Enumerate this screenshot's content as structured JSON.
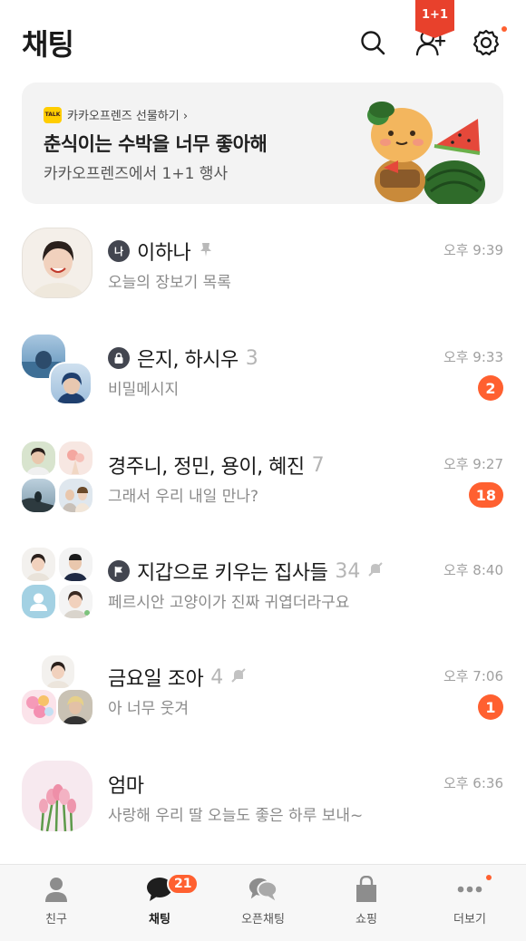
{
  "header": {
    "title": "채팅",
    "icons": [
      "search-icon",
      "add-friend-icon",
      "settings-icon"
    ],
    "settings_has_new": true
  },
  "banner": {
    "source": "카카오프렌즈 선물하기 ›",
    "source_logo": "TALK",
    "headline": "춘식이는 수박을 너무 좋아해",
    "subtitle": "카카오프렌즈에서 1+1 행사",
    "promo_tag": "1+1"
  },
  "chats": [
    {
      "name": "이하나",
      "count": "",
      "preview": "오늘의 장보기 목록",
      "time": "오후 9:39",
      "unread": "",
      "leading_icon": "나",
      "pinned": true,
      "muted": false
    },
    {
      "name": "은지, 하시우",
      "count": "3",
      "preview": "비밀메시지",
      "time": "오후 9:33",
      "unread": "2",
      "leading_icon": "lock-icon",
      "pinned": false,
      "muted": false
    },
    {
      "name": "경주니, 정민, 용이, 혜진",
      "count": "7",
      "preview": "그래서 우리 내일 만나?",
      "time": "오후 9:27",
      "unread": "18",
      "leading_icon": "",
      "pinned": false,
      "muted": false
    },
    {
      "name": "지갑으로 키우는 집사들",
      "count": "34",
      "preview": "페르시안 고양이가 진짜 귀엽더라구요",
      "time": "오후 8:40",
      "unread": "",
      "leading_icon": "flag-icon",
      "pinned": false,
      "muted": true
    },
    {
      "name": "금요일 조아",
      "count": "4",
      "preview": "아 너무 웃겨",
      "time": "오후 7:06",
      "unread": "1",
      "leading_icon": "",
      "pinned": false,
      "muted": true
    },
    {
      "name": "엄마",
      "count": "",
      "preview": "사랑해 우리 딸 오늘도 좋은 하루 보내~",
      "time": "오후 6:36",
      "unread": "",
      "leading_icon": "",
      "pinned": false,
      "muted": false
    }
  ],
  "tabs": [
    {
      "label": "친구",
      "icon": "person-icon",
      "active": false
    },
    {
      "label": "채팅",
      "icon": "chat-bubble-icon",
      "active": true,
      "badge": "21"
    },
    {
      "label": "오픈채팅",
      "icon": "open-chat-icon",
      "active": false
    },
    {
      "label": "쇼핑",
      "icon": "shopping-bag-icon",
      "active": false
    },
    {
      "label": "더보기",
      "icon": "more-icon",
      "active": false,
      "has_new": true
    }
  ],
  "colors": {
    "accent": "#ff6030",
    "banner_bg": "#f3f3f3",
    "muted_text": "#8a8a8a"
  }
}
